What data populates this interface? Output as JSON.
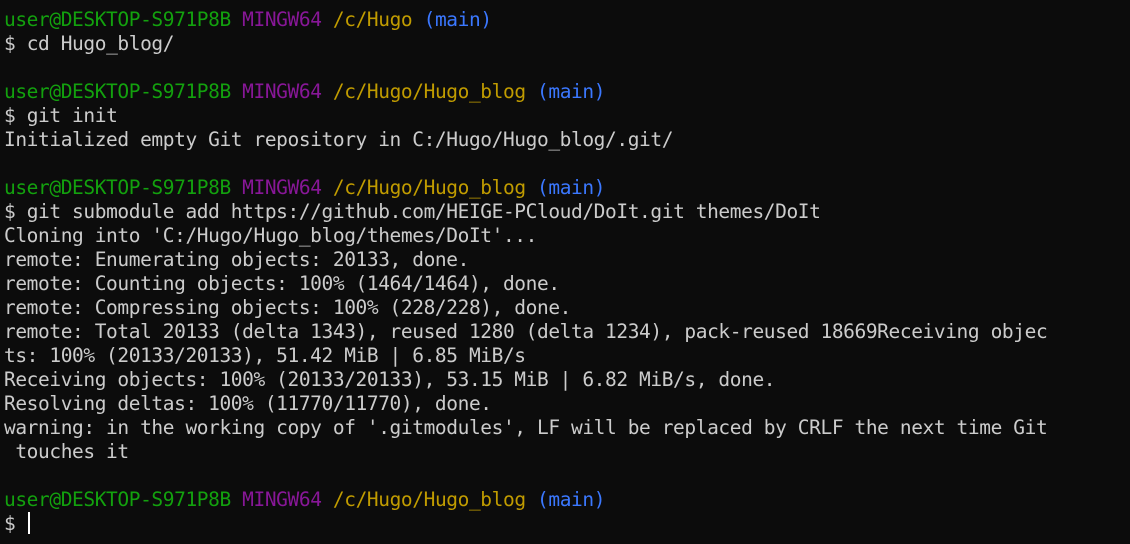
{
  "prompt": {
    "user_host": "user@DESKTOP-S971P8B",
    "system": "MINGW64",
    "branch": "(main)",
    "symbol": "$"
  },
  "blocks": [
    {
      "path": "/c/Hugo",
      "command": "cd Hugo_blog/",
      "output": []
    },
    {
      "path": "/c/Hugo/Hugo_blog",
      "command": "git init",
      "output": [
        "Initialized empty Git repository in C:/Hugo/Hugo_blog/.git/"
      ]
    },
    {
      "path": "/c/Hugo/Hugo_blog",
      "command": "git submodule add https://github.com/HEIGE-PCloud/DoIt.git themes/DoIt",
      "output": [
        "Cloning into 'C:/Hugo/Hugo_blog/themes/DoIt'...",
        "remote: Enumerating objects: 20133, done.",
        "remote: Counting objects: 100% (1464/1464), done.",
        "remote: Compressing objects: 100% (228/228), done.",
        "remote: Total 20133 (delta 1343), reused 1280 (delta 1234), pack-reused 18669Receiving objec",
        "ts: 100% (20133/20133), 51.42 MiB | 6.85 MiB/s",
        "Receiving objects: 100% (20133/20133), 53.15 MiB | 6.82 MiB/s, done.",
        "Resolving deltas: 100% (11770/11770), done.",
        "warning: in the working copy of '.gitmodules', LF will be replaced by CRLF the next time Git",
        " touches it"
      ]
    },
    {
      "path": "/c/Hugo/Hugo_blog",
      "command": "",
      "output": []
    }
  ],
  "colors": {
    "background": "#0c0c0c",
    "user": "#13a10e",
    "system": "#881798",
    "path": "#c19c00",
    "branch": "#3b78ff",
    "text": "#cccccc"
  }
}
